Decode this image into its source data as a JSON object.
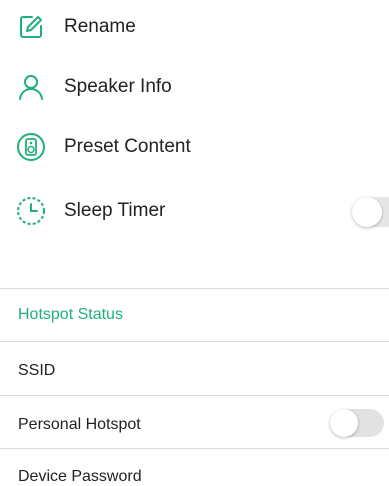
{
  "menu": {
    "items": [
      {
        "label": "Rename",
        "icon": "pencil-icon"
      },
      {
        "label": "Speaker Info",
        "icon": "user-icon"
      },
      {
        "label": "Preset Content",
        "icon": "speaker-icon"
      },
      {
        "label": "Sleep Timer",
        "icon": "clock-icon",
        "toggle_on": false
      }
    ]
  },
  "hotspot": {
    "section_title": "Hotspot Status",
    "ssid_label": "SSID",
    "personal_hotspot_label": "Personal Hotspot",
    "personal_hotspot_on": false,
    "device_password_label": "Device Password"
  },
  "colors": {
    "accent": "#20b07a",
    "divider": "#d9d9d9",
    "toggle_off_track": "#e6e6e6"
  }
}
